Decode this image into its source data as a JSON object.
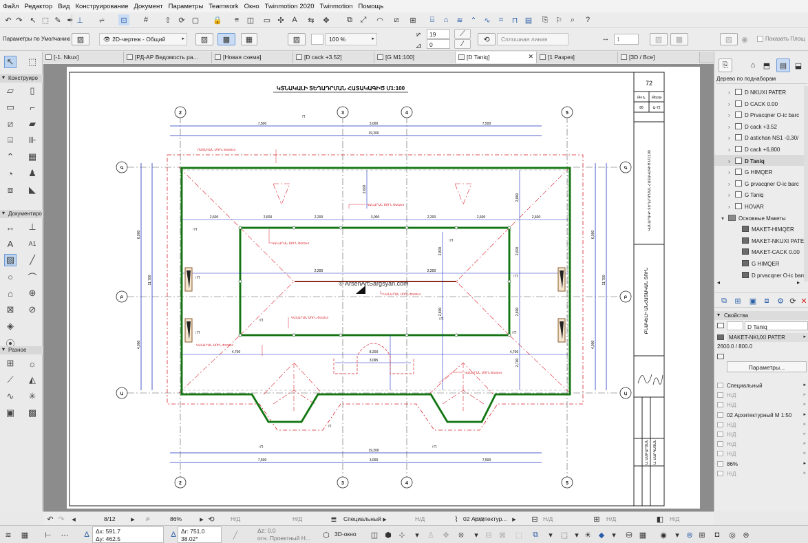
{
  "menu": [
    "Файл",
    "Редактор",
    "Вид",
    "Конструирование",
    "Документ",
    "Параметры",
    "Teamwork",
    "Окно",
    "Twinmotion 2020",
    "Twinmotion",
    "Помощь"
  ],
  "toolbar": {
    "defaults_label": "Параметры по Умолчанию",
    "layer_combo": "2D-чертеж - Общий",
    "zoom_field": "100 %",
    "value_top": "19",
    "value_bottom": "0",
    "line_type": "Сплошная линия",
    "scale_field": "1",
    "show_area_label": "Показать Площ"
  },
  "tabs": [
    {
      "label": "[-1. Nkux]"
    },
    {
      "label": "[РД-АР Ведомость ра..."
    },
    {
      "label": "[Новая схема]"
    },
    {
      "label": "[D cack +3.52]"
    },
    {
      "label": "[G M1:100]"
    },
    {
      "label": "[D Taniq]",
      "active": true
    },
    {
      "label": "[1 Разрез]"
    },
    {
      "label": "[3D / Все]"
    }
  ],
  "toolbox": {
    "section_construct": "Конструиро",
    "section_document": "Документиро",
    "section_misc": "Разное",
    "tool_a1": "A1"
  },
  "navigator": {
    "title": "Дерево по поднаборам",
    "items": [
      {
        "label": "D NKUXI PATER",
        "icon": "sheet"
      },
      {
        "label": "D CACK 0.00",
        "icon": "sheet"
      },
      {
        "label": "D Prvacqner O-ic barc",
        "icon": "sheet"
      },
      {
        "label": "D cack +3.52",
        "icon": "sheet"
      },
      {
        "label": "D astichan NS1 -0,30/",
        "icon": "sheet"
      },
      {
        "label": "D cack +6,800",
        "icon": "sheet"
      },
      {
        "label": "D Taniq",
        "icon": "sheet",
        "selected": true
      },
      {
        "label": "G HIMQER",
        "icon": "sheet"
      },
      {
        "label": "G prvacqner O-ic barc",
        "icon": "sheet"
      },
      {
        "label": "G Taniq",
        "icon": "sheet"
      },
      {
        "label": "HOVAR",
        "icon": "sheet"
      },
      {
        "label": "Основные Макеты",
        "icon": "folder"
      },
      {
        "label": "MAKET-HIMQER",
        "icon": "layout"
      },
      {
        "label": "MAKET-NKUXI PATER",
        "icon": "layout"
      },
      {
        "label": "MAKET-CACK 0.00",
        "icon": "layout"
      },
      {
        "label": "G HIMQER",
        "icon": "layout"
      },
      {
        "label": "D prvacqner O-ic barc",
        "icon": "layout"
      }
    ]
  },
  "properties": {
    "title": "Свойства",
    "name": "D Taniq",
    "layout": "MAKET-NKUXI PATER",
    "size": "2600.0 / 800.0",
    "params_button": "Параметры...",
    "rows": [
      {
        "label": "Специальный",
        "dim": false
      },
      {
        "label": "Н/Д",
        "dim": true
      },
      {
        "label": "Н/Д",
        "dim": true
      },
      {
        "label": "02 Архитектурный М 1:50",
        "dim": false
      },
      {
        "label": "Н/Д",
        "dim": true
      },
      {
        "label": "Н/Д",
        "dim": true
      },
      {
        "label": "Н/Д",
        "dim": true
      },
      {
        "label": "Н/Д",
        "dim": true
      },
      {
        "label": "86%",
        "dim": false
      },
      {
        "label": "Н/Д",
        "dim": true
      }
    ]
  },
  "drawing": {
    "title": "ԿՏՆԱԿԱԼԻ ՏԵՂԱԴՐՄԱՆ ՀԱՏԱԿԱԳԻԾ  Մ1:100",
    "watermark": "© ArsenArtSargsyan.com",
    "sheet_number": "72",
    "axis_top": [
      "2",
      "3",
      "4",
      "5"
    ],
    "axis_bottom": [
      "2",
      "3",
      "4",
      "5"
    ],
    "axis_left": [
      "Գ",
      "Բ",
      "Ա"
    ],
    "axis_right": [
      "Գ",
      "Բ",
      "Ա"
    ],
    "dims_top_row": [
      "7,500",
      "3,000",
      "7,500"
    ],
    "dims_top_total": "19,200",
    "dims_bottom_row": [
      "7,500",
      "3,000",
      "7,500"
    ],
    "dims_bottom_total": "19,200",
    "dims_inner": [
      "2,600",
      "2,600",
      "2,200",
      "3,000",
      "2,200",
      "2,600",
      "2,600"
    ],
    "dims_mid": [
      "2,200",
      "2,200"
    ],
    "dims_lower": [
      "4,700",
      "8,200",
      "4,700"
    ],
    "dim_small": "3,095",
    "dims_left": [
      "6,000",
      "11,700",
      "4,000"
    ],
    "dims_right": [
      "6,000",
      "11,700",
      "4,000"
    ],
    "dims_vertical_inner": [
      "2,800",
      "2,800",
      "2,600",
      "2,800",
      "2,800",
      "2,700",
      "2,600"
    ],
    "red_labels": [
      "ՈՍՏԱԿԱՆ ՍՈՒՆ 60x60x3",
      "ԿԱՆԱՐԱՆ ՍՈՒՆ Փ102x4",
      "ԿԱՆԱՐԱՆ ՍՈՒՆ Փ102x4",
      "ԿԱՆԱՐԱՆ ՍՈՒՆ Փ102x4",
      "ԿԱՆԱՐԱՆ ՍՈՒՆ Փ102x4",
      "ԿԱՆԱՐԱՆ ՍՈՒՆ Փ102x4",
      "ԿԱՆԱՐԱՆ ՍՈՒՆ Փ102x4"
    ],
    "title_block": {
      "row1": [
        "Թող.",
        "Թերթ"
      ],
      "row2": [
        "86",
        "Ա-72"
      ],
      "vertical_main": "ԿԱՆԱՐԱԿԻ ՏԵՂԱԴՐՄԱՆ ՀԱՏԱԿԱԳԻԾ Մ1:100",
      "vertical_project": "ԲՆԱԿԵԼԻ ԱՆՀԱՏԱԿԱՆ ՏՈՒՆ",
      "vertical_names": [
        "Ա. ԱՄԲԱՐՅԱՆ",
        "Ա. ՍԱՐԳՍՅԱՆ"
      ]
    }
  },
  "bottom": {
    "page": "8/12",
    "zoom": "86%",
    "nd1": "Н/Д",
    "nd2": "Н/Д",
    "combo_special": "Специальный",
    "nd3": "Н/Д",
    "nd4": "Н/Д",
    "combo_arch": "02 Архитектур...",
    "ax": "Δx: 591.7",
    "ay": "Δy: 462.5",
    "ar": "Δr: 751.0",
    "angle": "38.02°",
    "az": "Δz: 0.0",
    "proj": "отн. Проектный Н...",
    "view3d": "3D-окно"
  }
}
